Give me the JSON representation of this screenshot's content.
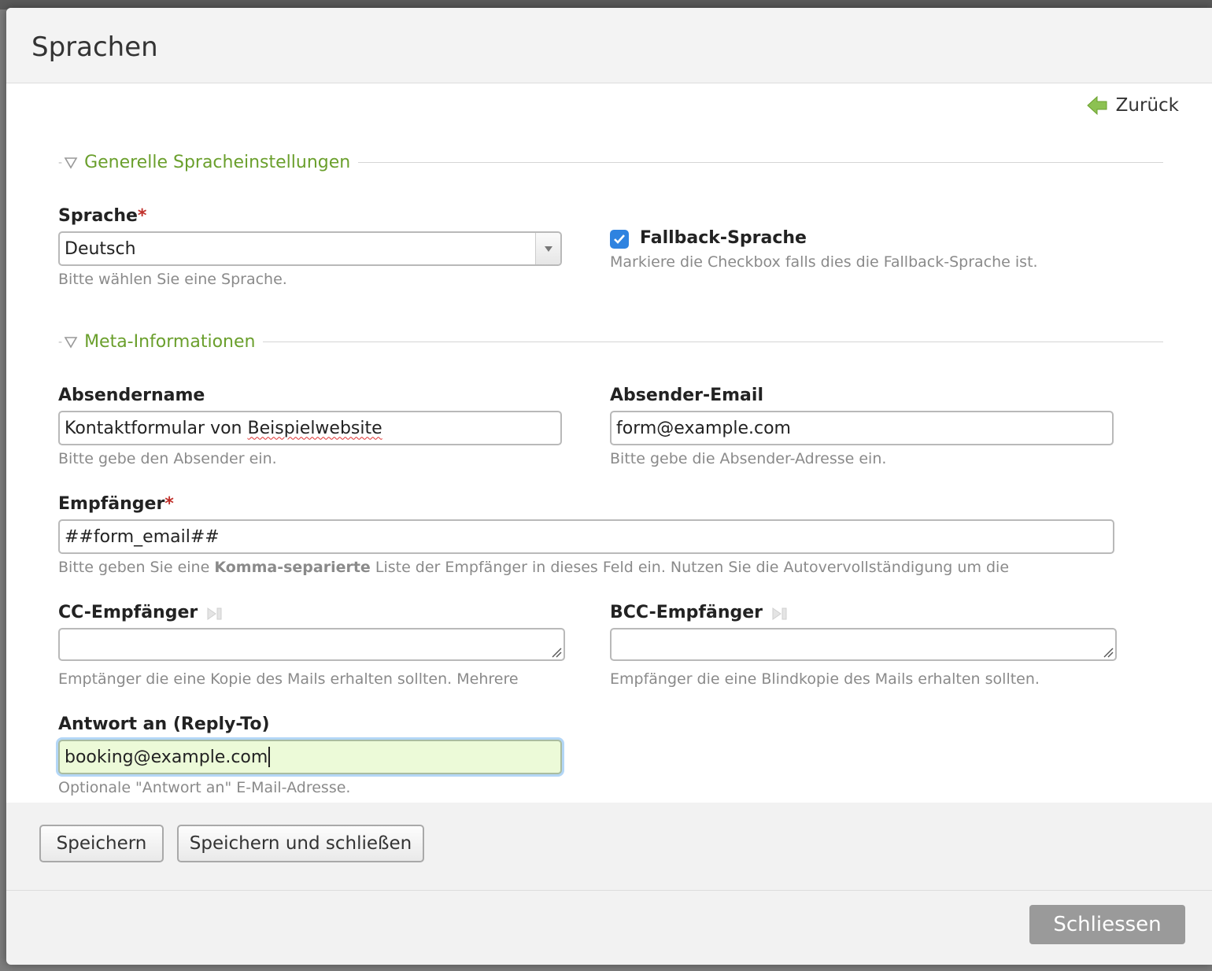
{
  "dialog": {
    "title": "Sprachen",
    "back_label": "Zurück"
  },
  "section_general": {
    "legend": "Generelle Spracheinstellungen",
    "language_label": "Sprache",
    "language_value": "Deutsch",
    "language_help": "Bitte wählen Sie eine Sprache.",
    "fallback_label": "Fallback-Sprache",
    "fallback_checked": true,
    "fallback_help": "Markiere die Checkbox falls dies die Fallback-Sprache ist."
  },
  "section_meta": {
    "legend": "Meta-Informationen",
    "sender_name_label": "Absendername",
    "sender_name_value_a": "Kontaktformular von ",
    "sender_name_value_b": "Beispielwebsite",
    "sender_name_help": "Bitte gebe den Absender ein.",
    "sender_email_label": "Absender-Email",
    "sender_email_value": "form@example.com",
    "sender_email_help": "Bitte gebe die Absender-Adresse ein.",
    "recipient_label": "Empfänger",
    "recipient_value": "##form_email##",
    "recipient_help_a": "Bitte geben Sie eine ",
    "recipient_help_bold": "Komma-separierte",
    "recipient_help_b": " Liste der Empfänger in dieses Feld ein. Nutzen Sie die Autovervollständigung um die",
    "cc_label": "CC-Empfänger",
    "cc_value": "",
    "cc_help": "Emptänger die eine Kopie des Mails erhalten sollten. Mehrere",
    "bcc_label": "BCC-Empfänger",
    "bcc_value": "",
    "bcc_help": "Empfänger die eine Blindkopie des Mails erhalten sollten.",
    "reply_to_label": "Antwort an (Reply-To)",
    "reply_to_value": "booking@example.com",
    "reply_to_help": "Optionale \"Antwort an\" E-Mail-Adresse."
  },
  "buttons": {
    "save": "Speichern",
    "save_close": "Speichern und schließen",
    "close": "Schliessen"
  },
  "required_marker": "*",
  "colors": {
    "accent_green": "#6a9f2c",
    "required_red": "#c0302a",
    "checkbox_blue": "#2f83e0",
    "focus_bg": "#ecfad8"
  },
  "icons": {
    "back": "green-left-arrow-icon",
    "legend_toggle": "triangle-down-icon",
    "select_arrow": "chevron-down-icon",
    "picker": "next-track-icon",
    "resize": "resize-grip-icon",
    "check": "checkmark-icon"
  }
}
